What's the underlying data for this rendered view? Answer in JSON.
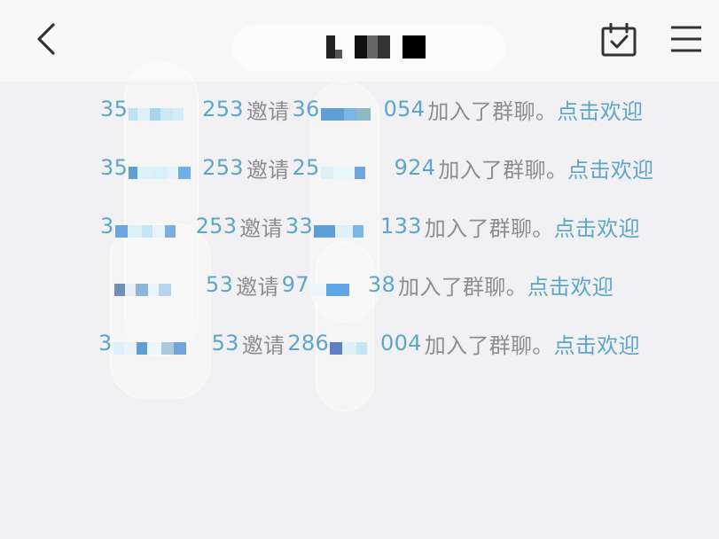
{
  "header": {
    "title": "",
    "back_icon": "chevron-left-icon",
    "calendar_icon": "calendar-check-icon",
    "menu_icon": "menu-icon"
  },
  "colors": {
    "id_text": "#5ea6c9",
    "verb_text": "#8d8d90",
    "link_text": "#5ea6c9",
    "header_bg": "#f7f7f8",
    "page_bg": "#f1f1f3"
  },
  "messages": [
    {
      "inviter_start": "35",
      "inviter_end": "253",
      "verb": "邀请",
      "invitee_start": "36",
      "invitee_end": "054",
      "joined": "加入了群聊。",
      "action": "点击欢迎"
    },
    {
      "inviter_start": "35",
      "inviter_end": "253",
      "verb": "邀请",
      "invitee_start": "25",
      "invitee_end": "924",
      "joined": "加入了群聊。",
      "action": "点击欢迎"
    },
    {
      "inviter_start": "3",
      "inviter_end": "253",
      "verb": "邀请",
      "invitee_start": "33",
      "invitee_end": "133",
      "joined": "加入了群聊。",
      "action": "点击欢迎"
    },
    {
      "inviter_start": "",
      "inviter_end": "53",
      "verb": "邀请",
      "invitee_start": "97",
      "invitee_end": "38",
      "joined": "加入了群聊。",
      "action": "点击欢迎"
    },
    {
      "inviter_start": "3",
      "inviter_end": "53",
      "verb": "邀请",
      "invitee_start": "286",
      "invitee_end": "004",
      "joined": "加入了群聊。",
      "action": "点击欢迎"
    }
  ]
}
